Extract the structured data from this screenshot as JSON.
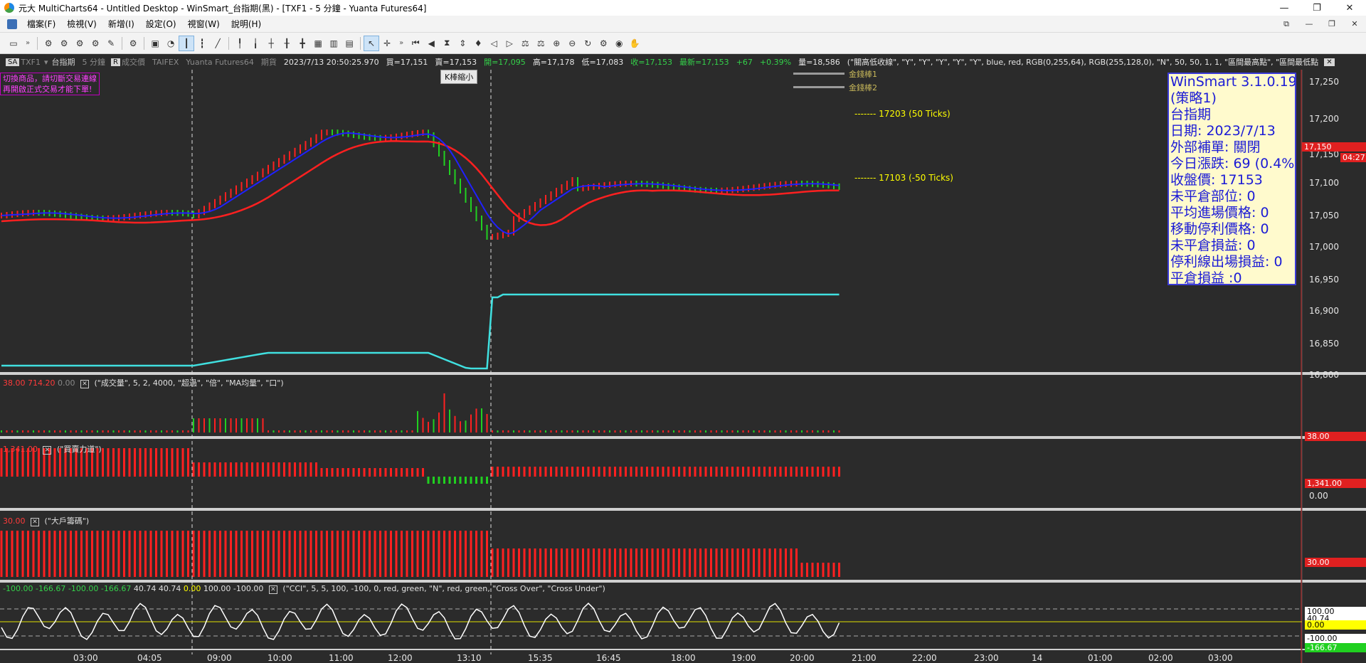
{
  "window": {
    "title": "元大 MultiCharts64 - Untitled Desktop - WinSmart_台指期(黑) - [TXF1 - 5 分鐘 - Yuanta Futures64]",
    "minimize": "—",
    "maximize": "❐",
    "close": "✕"
  },
  "menu": {
    "items": [
      "檔案(F)",
      "檢視(V)",
      "新增(I)",
      "設定(O)",
      "視窗(W)",
      "說明(H)"
    ]
  },
  "chart_header": {
    "symbol_button": "SA",
    "symbol": "TXF1",
    "symbol_name": "台指期",
    "interval": "5 分鐘",
    "range_button": "R",
    "data_type": "成交價",
    "exchange": "TAIFEX",
    "data_feed": "Yuanta Futures64",
    "category": "期貨",
    "datetime": "2023/7/13  20:50:25.970",
    "bid": "買=17,151",
    "ask": "賣=17,153",
    "open": "開=17,095",
    "high": "高=17,178",
    "low": "低=17,083",
    "close": "收=17,153",
    "last": "最新=17,153",
    "change": "+67",
    "change_pct": "+0.39%",
    "volume": "量=18,586",
    "study_args": "(\"關高低收線\", \"Y\", \"Y\", \"Y\", \"Y\", \"Y\", blue, red, RGB(0,255,64), RGB(255,128,0), \"N\", 50, 50, 1, 1, \"區間最高點\", \"區間最低點",
    "study_close": "✕"
  },
  "warning_text": [
    "切換商品，請切斷交易連線",
    "再開啟正式交易才能下單!"
  ],
  "zoom_tip": "K棒縮小",
  "gold_lines": [
    "金錢棒1",
    "金錢棒2"
  ],
  "tick_lines": [
    "17203 (50 Ticks)",
    "17103 (-50 Ticks)"
  ],
  "info_box": {
    "lines": [
      "WinSmart 3.1.0.19",
      "(策略1)",
      "台指期",
      "日期: 2023/7/13",
      "外部補單: 關閉",
      "今日漲跌: 69 (0.4%)",
      "收盤價: 17153",
      "未平倉部位: 0",
      "平均進場價格: 0",
      "移動停利價格: 0",
      "未平倉損益: 0",
      "停利線出場損益: 0",
      "平倉損益 :0"
    ]
  },
  "price_axis": {
    "labels": [
      "17,250",
      "17,200",
      "17,150",
      "17,100",
      "17,050",
      "17,000",
      "16,950",
      "16,900",
      "16,850",
      "16,800"
    ],
    "last_price_tag": "17,150",
    "countdown_tag": "04:27"
  },
  "panels": {
    "volume": {
      "values": [
        "38.00",
        "714.20",
        "0.00"
      ],
      "args": "(\"成交量\", 5, 2, 4000, \"超過\", \"倍\", \"MA均量\", \"口\")",
      "axis_tag": "38.00"
    },
    "buy_sell": {
      "value": "1,341.00",
      "args": "(\"買賣力道\")",
      "axis_tag": "1,341.00",
      "axis_zero": "0.00"
    },
    "big_holder": {
      "value": "30.00",
      "args": "(\"大戶籌碼\")",
      "axis_tag": "30.00"
    },
    "cci": {
      "values": [
        "-100.00",
        "-166.67",
        "-100.00",
        "-166.67",
        "40.74",
        "40.74",
        "0.00",
        "100.00",
        "-100.00"
      ],
      "args": "(\"CCI\", 5, 5, 100, -100, 0, red, green, \"N\", red, green, \"Cross Over\", \"Cross Under\")",
      "axis_labels": [
        "100.00",
        "40.74",
        "0.00",
        "-100.00",
        "-166.67"
      ]
    }
  },
  "time_axis": [
    "03:00",
    "04:05",
    "09:00",
    "10:00",
    "11:00",
    "12:00",
    "13:10",
    "15:35",
    "16:45",
    "18:00",
    "19:00",
    "20:00",
    "21:00",
    "22:00",
    "23:00",
    "14",
    "01:00",
    "02:00",
    "03:00"
  ],
  "colors": {
    "background": "#2b2b2b",
    "up_bar": "#ff2020",
    "down_bar": "#20d020",
    "ma_fast": "#2020ff",
    "ma_slow": "#ff2020",
    "cyan_line": "#40e0e0",
    "panel_border": "#d0d0d0"
  }
}
